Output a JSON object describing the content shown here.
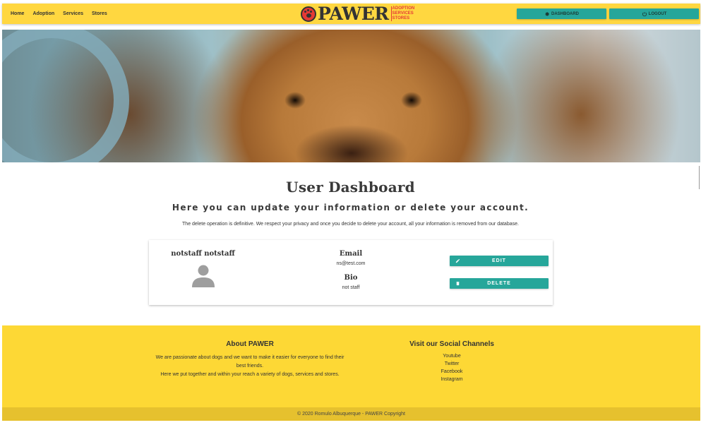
{
  "nav": {
    "links": [
      "Home",
      "Adoption",
      "Services",
      "Stores"
    ],
    "brand": {
      "name": "PAWER",
      "tags": [
        "ADOPTION",
        "SERVICES",
        "STORES"
      ]
    },
    "dashboard_label": "DASHBOARD",
    "logout_label": "LOGOUT"
  },
  "dashboard": {
    "title": "User Dashboard",
    "subtitle": "Here you can update your information or delete your account.",
    "note": "The delete operation is definitive. We respect your privacy and once you decide to delete your account, all your information is removed from our database."
  },
  "user": {
    "name": "notstaff notstaff",
    "email_label": "Email",
    "email": "ns@test.com",
    "bio_label": "Bio",
    "bio": "not staff",
    "edit_label": "EDIT",
    "delete_label": "DELETE"
  },
  "footer": {
    "about_title": "About PAWER",
    "about_text_1": "We are passionate about dogs and we want to make it easier for everyone to find their best friends.",
    "about_text_2": "Here we put together and within your reach a variety of dogs, services and stores.",
    "social_title": "Visit our Social Channels",
    "social_links": [
      "Youtube",
      "Twitter",
      "Facebook",
      "Instagram"
    ],
    "copyright": "© 2020 Romulo Albuquerque - PAWER Copyright"
  },
  "colors": {
    "navbar": "#ffd740",
    "accent": "#26a69a",
    "footer": "#fdd835",
    "brand_red": "#e53935"
  },
  "icons": {
    "dashboard": "gear-icon",
    "logout": "power-icon",
    "edit": "pencil-icon",
    "delete": "trash-icon",
    "avatar": "person-icon",
    "logo": "paw-icon"
  }
}
